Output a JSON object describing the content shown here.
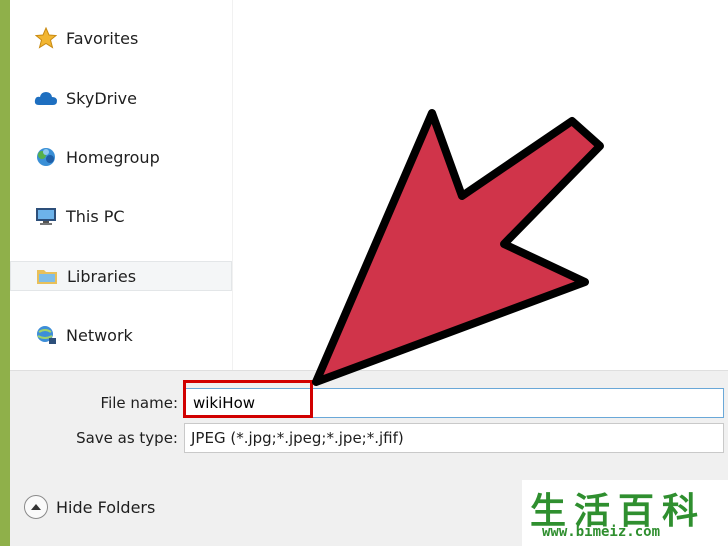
{
  "nav": {
    "items": [
      {
        "label": "Favorites",
        "icon": "star-icon"
      },
      {
        "label": "SkyDrive",
        "icon": "cloud-icon"
      },
      {
        "label": "Homegroup",
        "icon": "homegroup-icon"
      },
      {
        "label": "This PC",
        "icon": "computer-icon"
      },
      {
        "label": "Libraries",
        "icon": "libraries-icon",
        "selected": true
      },
      {
        "label": "Network",
        "icon": "network-icon"
      }
    ]
  },
  "form": {
    "file_name_label": "File name:",
    "file_name_value": "wikiHow",
    "save_as_type_label": "Save as type:",
    "save_as_type_value": "JPEG (*.jpg;*.jpeg;*.jpe;*.jfif)"
  },
  "footer": {
    "hide_folders_label": "Hide Folders"
  },
  "watermark": {
    "chars": [
      "生",
      "活",
      "百",
      "科"
    ],
    "url": "www.bimeiz.com"
  },
  "colors": {
    "frame": "#8fb04a",
    "highlight": "#d10000",
    "arrow_fill": "#d0344a",
    "input_border": "#6aa8d8"
  }
}
